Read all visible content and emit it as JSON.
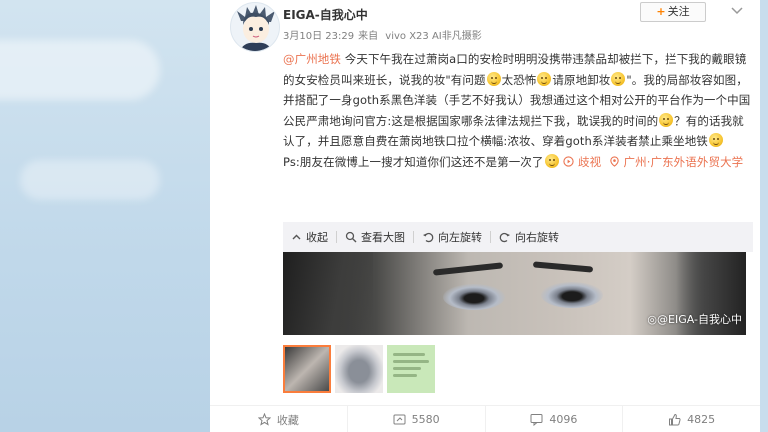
{
  "author": {
    "name": "EIGA-自我心中"
  },
  "post_meta": {
    "date": "3月10日 23:29",
    "source_prefix": "来自",
    "source_device": "vivo X23 AI非凡摄影"
  },
  "follow_button": {
    "label": "关注"
  },
  "post": {
    "mention": "@广州地铁",
    "text_1": " 今天下午我在过萧岗a口的安检时明明没携带违禁品却被拦下，拦下我的戴眼镜的女安检员叫来班长，说我的妆\"有问题",
    "text_2": "太恐怖",
    "text_3": "请原地卸妆",
    "text_4": "\"。我的局部妆容如图，并搭配了一身goth系黑色洋装（手艺不好我认）我想通过这个相对公开的平台作为一个中国公民严肃地询问官方:这是根据国家哪条法律法规拦下我，耽误我的时间的",
    "text_5": "？有的话我就认了，并且愿意自费在萧岗地铁口拉个横幅:浓妆、穿着goth系洋装者禁止乘坐地铁",
    "text_6": "Ps:朋友在微博上一搜才知道你们这还不是第一次了",
    "video_link": "歧视",
    "location_link": "广州·广东外语外贸大学"
  },
  "toolbar": {
    "collect": "收起",
    "view_large": "查看大图",
    "rotate_left": "向左旋转",
    "rotate_right": "向右旋转"
  },
  "image_watermark": "@EIGA-自我心中",
  "footer": {
    "favorite": "收藏",
    "repost": "5580",
    "comment": "4096",
    "like": "4825"
  },
  "colors": {
    "link": "#eb7350",
    "accent": "#ff8200",
    "selected_thumb_border": "#fa7d3c"
  }
}
